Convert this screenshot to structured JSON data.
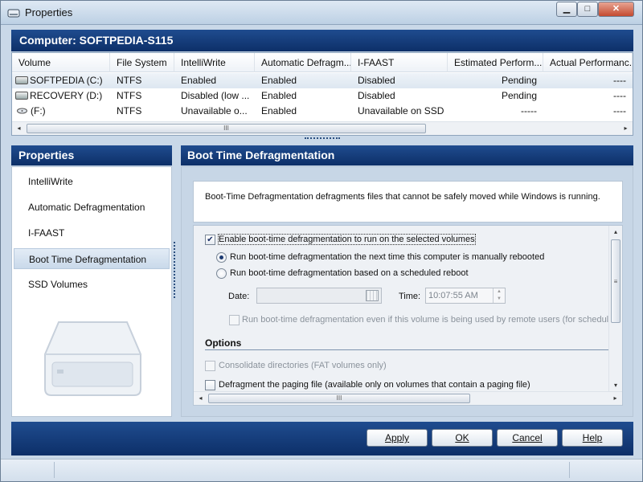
{
  "window": {
    "title": "Properties",
    "min_glyph": "▁",
    "max_glyph": "□",
    "close_glyph": "✕"
  },
  "header": {
    "computer": "Computer: SOFTPEDIA-S115"
  },
  "volumes": {
    "columns": [
      "Volume",
      "File System",
      "IntelliWrite",
      "Automatic Defragm...",
      "I-FAAST",
      "Estimated Perform...",
      "Actual Performanc..."
    ],
    "rows": [
      {
        "volume": "SOFTPEDIA (C:)",
        "icon": "hard-drive-icon",
        "fs": "NTFS",
        "intelliwrite": "Enabled",
        "auto": "Enabled",
        "ifaast": "Disabled",
        "est": "Pending",
        "actual": "----"
      },
      {
        "volume": "RECOVERY (D:)",
        "icon": "hard-drive-icon",
        "fs": "NTFS",
        "intelliwrite": "Disabled (low ...",
        "auto": "Enabled",
        "ifaast": "Disabled",
        "est": "Pending",
        "actual": "----"
      },
      {
        "volume": "(F:)",
        "icon": "cd-drive-icon",
        "fs": "NTFS",
        "intelliwrite": "Unavailable o...",
        "auto": "Enabled",
        "ifaast": "Unavailable on SSD",
        "est": "-----",
        "actual": "----"
      }
    ],
    "scroll_left_glyph": "◂",
    "scroll_right_glyph": "▸",
    "thumb_grip": "III"
  },
  "left": {
    "title": "Properties",
    "items": [
      {
        "label": "IntelliWrite",
        "active": false
      },
      {
        "label": "Automatic Defragmentation",
        "active": false
      },
      {
        "label": "I-FAAST",
        "active": false
      },
      {
        "label": "Boot Time Defragmentation",
        "active": true
      },
      {
        "label": "SSD Volumes",
        "active": false
      }
    ]
  },
  "right": {
    "title": "Boot Time Defragmentation",
    "description": "Boot-Time Defragmentation defragments files that cannot be safely moved while Windows is running.",
    "enable_label": "Enable boot-time defragmentation to run on the selected volumes",
    "enable_checked": true,
    "enable_check_glyph": "✔",
    "radio_next": "Run boot-time defragmentation the next time this computer is manually rebooted",
    "radio_scheduled": "Run boot-time defragmentation based on a scheduled reboot",
    "date_label": "Date:",
    "time_label": "Time:",
    "time_value": "10:07:55 AM",
    "spin_up_glyph": "▲",
    "spin_down_glyph": "▼",
    "remote_label": "Run boot-time defragmentation even if this volume is being used by remote users (for scheduled d",
    "options_title": "Options",
    "consolidate_label": "Consolidate directories (FAT volumes only)",
    "paging_label": "Defragment the paging file (available only on volumes that contain a paging file)",
    "scroll_up_glyph": "▴",
    "scroll_down_glyph": "▾",
    "thumb_grip": "≡"
  },
  "footer": {
    "apply": "Apply",
    "ok": "OK",
    "cancel": "Cancel",
    "help": "Help"
  },
  "colors": {
    "header_bg": "#0d2f68",
    "panel_bg": "#c7d6e6"
  }
}
